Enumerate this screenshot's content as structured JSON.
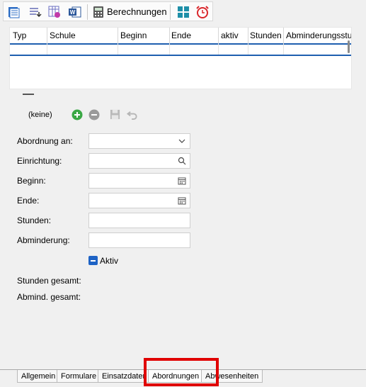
{
  "toolbar": {
    "calculations_label": "Berechnungen",
    "icons": [
      "list-icon",
      "export-icon",
      "schedule-icon",
      "word-icon",
      "calculator-icon",
      "dashboard-icon",
      "alarm-clock-icon"
    ]
  },
  "grid": {
    "columns": [
      "Typ",
      "Schule",
      "Beginn",
      "Ende",
      "aktiv",
      "Stunden",
      "Abminderungsstu"
    ]
  },
  "record_nav": {
    "current": "(keine)"
  },
  "form": {
    "abordnung_label": "Abordnung an:",
    "abordnung_value": "",
    "einrichtung_label": "Einrichtung:",
    "einrichtung_value": "",
    "beginn_label": "Beginn:",
    "beginn_value": "",
    "ende_label": "Ende:",
    "ende_value": "",
    "stunden_label": "Stunden:",
    "stunden_value": "",
    "abminderung_label": "Abminderung:",
    "abminderung_value": "",
    "aktiv_label": "Aktiv",
    "stunden_gesamt_label": "Stunden gesamt:",
    "abmind_gesamt_label": "Abmind. gesamt:"
  },
  "tabs": [
    {
      "label": "Allgemein"
    },
    {
      "label": "Formulare"
    },
    {
      "label": "Einsatzdaten"
    },
    {
      "label": "Abordnungen"
    },
    {
      "label": "Abwesenheiten"
    }
  ],
  "colors": {
    "accent": "#1e63c5",
    "highlight": "#e00000",
    "add": "#3aa845"
  }
}
